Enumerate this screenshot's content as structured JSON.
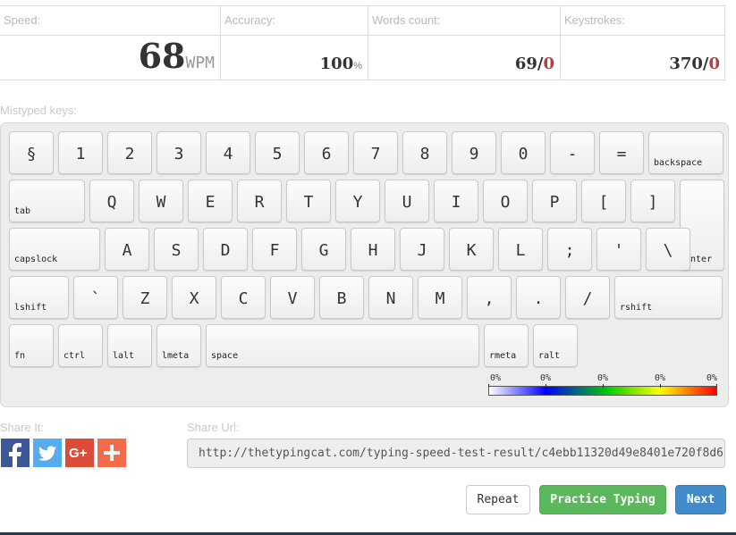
{
  "stats": {
    "speed": {
      "label": "Speed:",
      "value": "68",
      "unit": "WPM"
    },
    "accuracy": {
      "label": "Accuracy:",
      "value": "100",
      "unit": "%"
    },
    "words": {
      "label": "Words count:",
      "value": "69/",
      "errors": "0"
    },
    "keystrokes": {
      "label": "Keystrokes:",
      "value": "370/",
      "errors": "0"
    }
  },
  "mistyped": {
    "label": "Mistyped keys:"
  },
  "keyboard": {
    "row1": [
      "§",
      "1",
      "2",
      "3",
      "4",
      "5",
      "6",
      "7",
      "8",
      "9",
      "0",
      "-",
      "=",
      "backspace"
    ],
    "row2": [
      "tab",
      "Q",
      "W",
      "E",
      "R",
      "T",
      "Y",
      "U",
      "I",
      "O",
      "P",
      "[",
      "]",
      "enter"
    ],
    "row3": [
      "capslock",
      "A",
      "S",
      "D",
      "F",
      "G",
      "H",
      "J",
      "K",
      "L",
      ";",
      "'",
      "\\"
    ],
    "row4": [
      "lshift",
      "`",
      "Z",
      "X",
      "C",
      "V",
      "B",
      "N",
      "M",
      ",",
      ".",
      "/",
      "rshift"
    ],
    "row5": [
      "fn",
      "ctrl",
      "lalt",
      "lmeta",
      "space",
      "rmeta",
      "ralt"
    ],
    "legend": {
      "labels": [
        "0%",
        "0%",
        "0%",
        "0%",
        "0%"
      ],
      "colors": [
        "#ffffff",
        "#0000ff",
        "#00cc00",
        "#ffff00",
        "#ff0000"
      ]
    }
  },
  "share": {
    "label": "Share It:",
    "icons": [
      "facebook-icon",
      "twitter-icon",
      "google-plus-icon",
      "add-more-icon"
    ],
    "icon_colors": {
      "facebook": "#3b5998",
      "twitter": "#55acee",
      "google_plus": "#dd4b39",
      "add": "#f26b4a"
    },
    "url_label": "Share Url:",
    "url": "http://thetypingcat.com/typing-speed-test-result/c4ebb11320d49e8401e720f8d6"
  },
  "buttons": {
    "repeat": "Repeat",
    "practice": "Practice Typing",
    "next": "Next"
  }
}
